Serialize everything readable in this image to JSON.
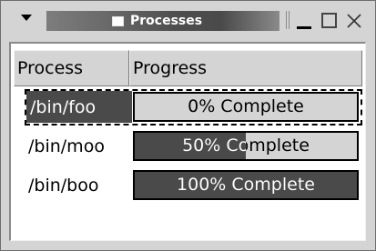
{
  "window": {
    "title": "Processes"
  },
  "table": {
    "columns": [
      "Process",
      "Progress"
    ],
    "rows": [
      {
        "process": "/bin/foo",
        "progress_percent": 0,
        "progress_label": "0% Complete",
        "selected": true
      },
      {
        "process": "/bin/moo",
        "progress_percent": 50,
        "progress_label": "50% Complete",
        "selected": false
      },
      {
        "process": "/bin/boo",
        "progress_percent": 100,
        "progress_label": "100% Complete",
        "selected": false
      }
    ]
  },
  "icons": {
    "window_menu": "triangle-down-icon",
    "window_app": "window-icon",
    "minimize": "minimize-icon",
    "maximize": "maximize-icon",
    "close": "close-icon"
  },
  "colors": {
    "progress_fill": "#4a4a4a",
    "progress_track": "#d4d4d4",
    "selection": "#4a4a4a",
    "window_bg": "#d4d4d4"
  }
}
